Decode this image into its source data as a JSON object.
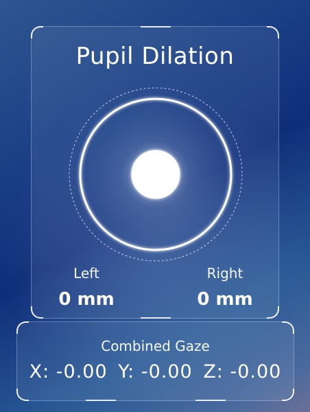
{
  "pupil": {
    "title": "Pupil Dilation",
    "left_label": "Left",
    "right_label": "Right",
    "left_value": "0 mm",
    "right_value": "0 mm"
  },
  "gaze": {
    "title": "Combined Gaze",
    "x": "X: -0.00",
    "y": "Y: -0.00",
    "z": "Z: -0.00"
  },
  "colors": {
    "background_top": "#1a3f86",
    "background_bottom": "#6d6f96",
    "text": "#ffffff",
    "ring_glow": "#dfe9ff"
  }
}
